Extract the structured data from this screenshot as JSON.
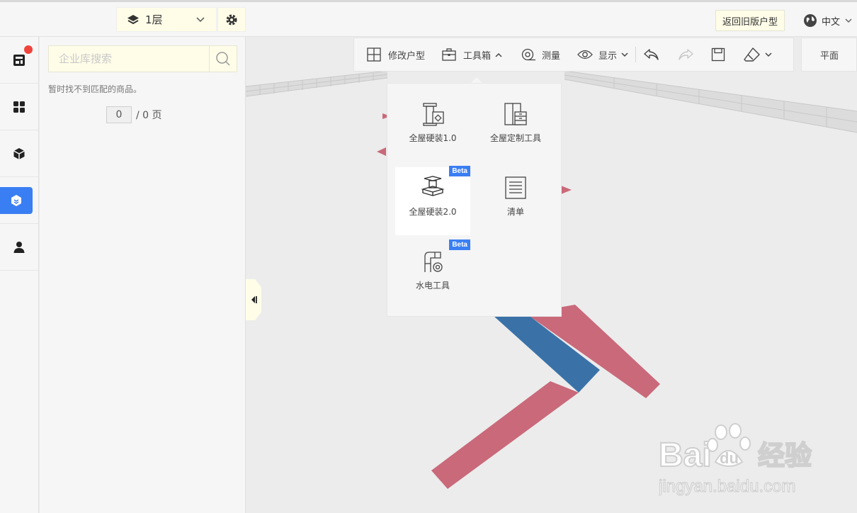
{
  "topbar": {
    "floor_label": "1层",
    "old_plan_button": "返回旧版户型",
    "language": "中文"
  },
  "library": {
    "search_placeholder": "企业库搜索",
    "empty_message": "暂时找不到匹配的商品。",
    "page_current": "0",
    "page_total": "/ 0 页"
  },
  "toolbar": {
    "edit_plan": "修改户型",
    "toolbox": "工具箱",
    "measure": "测量",
    "display": "显示",
    "view_2d": "平面"
  },
  "toolbox_menu": {
    "items": [
      {
        "label": "全屋硬装1.0",
        "icon": "pillar-tile-icon",
        "beta": false
      },
      {
        "label": "全屋定制工具",
        "icon": "cabinet-icon",
        "beta": false
      },
      {
        "label": "全屋硬装2.0",
        "icon": "stacked-ibeam-icon",
        "beta": true,
        "badge": "Beta"
      },
      {
        "label": "清单",
        "icon": "list-icon",
        "beta": false
      },
      {
        "label": "水电工具",
        "icon": "pipe-valve-icon",
        "beta": true,
        "badge": "Beta"
      }
    ]
  },
  "watermark": {
    "logo_text": "Bai经验",
    "url_text": "jingyan.baidu.com"
  },
  "colors": {
    "accent": "#3a7ef4",
    "badge_red": "#f0433b",
    "wall_pink": "#c9697a",
    "wall_blue": "#3a72a8",
    "input_bg": "#fffde8"
  }
}
